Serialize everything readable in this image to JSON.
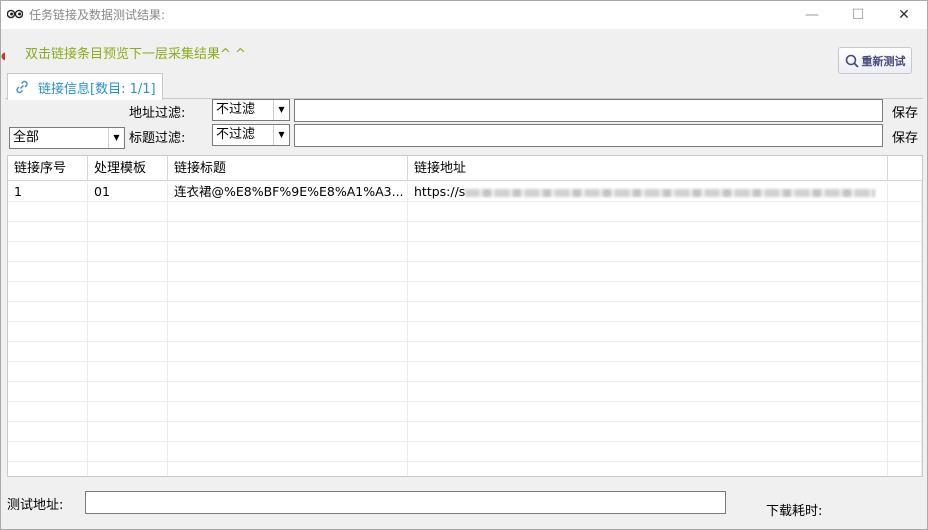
{
  "window": {
    "title": "任务链接及数据测试结果:",
    "controls": {
      "minimize": "—",
      "maximize": "☐",
      "close": "✕"
    }
  },
  "hint": "双击链接条目预览下一层采集结果^ ^",
  "toolbar": {
    "retest_label": "重新测试"
  },
  "tab": {
    "label": "链接信息[数目: 1/1]"
  },
  "filters": {
    "scope_select": "全部",
    "address_filter": {
      "label": "地址过滤:",
      "mode": "不过滤",
      "value": "",
      "save_label": "保存"
    },
    "title_filter": {
      "label": "标题过滤:",
      "mode": "不过滤",
      "value": "",
      "save_label": "保存"
    }
  },
  "grid": {
    "columns": [
      "链接序号",
      "处理模板",
      "链接标题",
      "链接地址"
    ],
    "rows": [
      {
        "index": "1",
        "template": "01",
        "title": "连衣裙@%E8%BF%9E%E8%A1%A3...",
        "url_prefix": "https://s"
      }
    ]
  },
  "bottom": {
    "test_address_label": "测试地址:",
    "test_address_value": "",
    "download_time_label": "下载耗时:"
  },
  "colors": {
    "hint": "#8aae1b",
    "tab_text": "#2b8fd0",
    "button_text": "#4a4a7a"
  },
  "icons": {
    "app": "eyes-icon",
    "retest": "search-icon",
    "tab": "link-icon"
  }
}
